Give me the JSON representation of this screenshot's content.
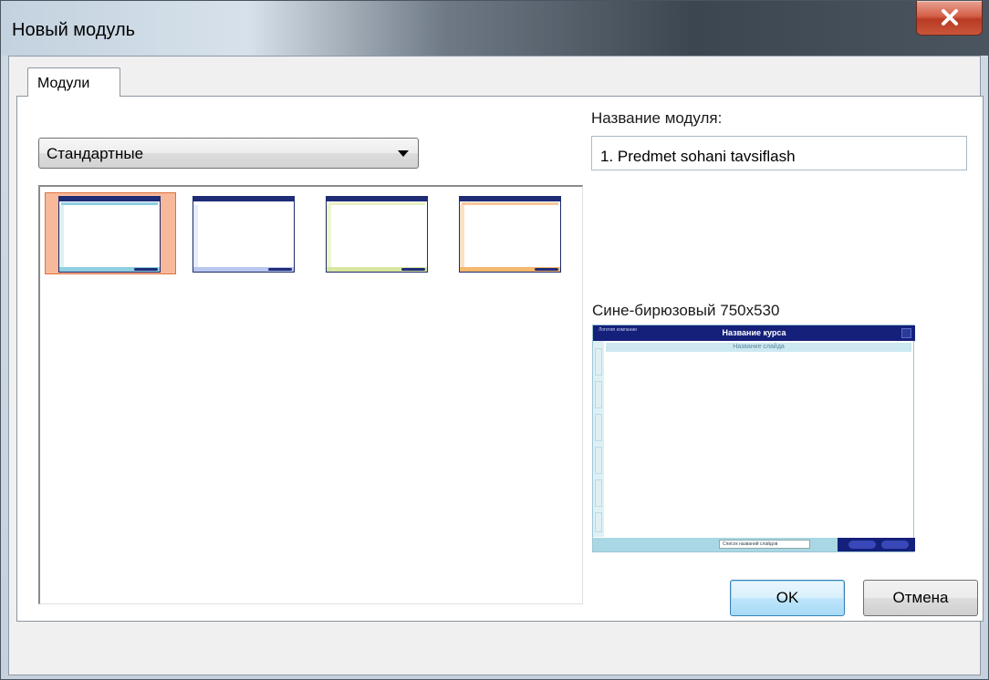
{
  "window": {
    "title": "Новый модуль"
  },
  "tabs": [
    {
      "label": "Модули"
    }
  ],
  "category": {
    "selected": "Стандартные"
  },
  "module_name": {
    "label": "Название модуля:",
    "value": "1. Predmet sohani tavsiflash"
  },
  "templates": [
    {
      "id": "t1",
      "accent": "#8ecfe0",
      "selected": true
    },
    {
      "id": "t2",
      "accent": "#b9c6ee",
      "selected": false
    },
    {
      "id": "t3",
      "accent": "#d8e6a0",
      "selected": false
    },
    {
      "id": "t4",
      "accent": "#f5b86e",
      "selected": false
    }
  ],
  "preview": {
    "caption": "Сине-бирюзовый 750x530",
    "logo_text": "Логотип компании",
    "course_title": "Название курса",
    "slide_title": "Название слайда",
    "bottom_select": "Список названий слайдов"
  },
  "buttons": {
    "ok": "OK",
    "cancel": "Отмена"
  },
  "colors": {
    "selection": "#f8b99a",
    "header": "#1f2c78",
    "ok_accent": "#3c7fb1"
  }
}
